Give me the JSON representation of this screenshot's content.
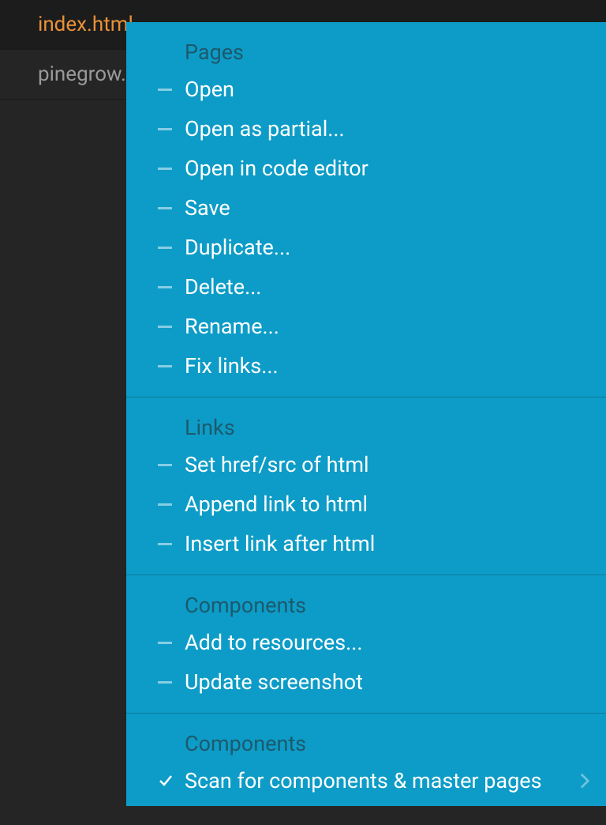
{
  "files": [
    {
      "name": "index.html",
      "active": true
    },
    {
      "name": "pinegrow.",
      "active": false
    }
  ],
  "menu": {
    "sections": [
      {
        "title": "Pages",
        "items": [
          {
            "label": "Open",
            "icon": "dash"
          },
          {
            "label": "Open as partial...",
            "icon": "dash"
          },
          {
            "label": "Open in code editor",
            "icon": "dash"
          },
          {
            "label": "Save",
            "icon": "dash"
          },
          {
            "label": "Duplicate...",
            "icon": "dash"
          },
          {
            "label": "Delete...",
            "icon": "dash"
          },
          {
            "label": "Rename...",
            "icon": "dash"
          },
          {
            "label": "Fix links...",
            "icon": "dash"
          }
        ]
      },
      {
        "title": "Links",
        "items": [
          {
            "label": "Set href/src of html",
            "icon": "dash"
          },
          {
            "label": "Append link to html",
            "icon": "dash"
          },
          {
            "label": "Insert link after html",
            "icon": "dash"
          }
        ]
      },
      {
        "title": "Components",
        "items": [
          {
            "label": "Add to resources...",
            "icon": "dash"
          },
          {
            "label": "Update screenshot",
            "icon": "dash"
          }
        ]
      },
      {
        "title": "Components",
        "items": [
          {
            "label": "Scan for components & master pages",
            "icon": "check",
            "submenu": true
          }
        ]
      }
    ]
  }
}
